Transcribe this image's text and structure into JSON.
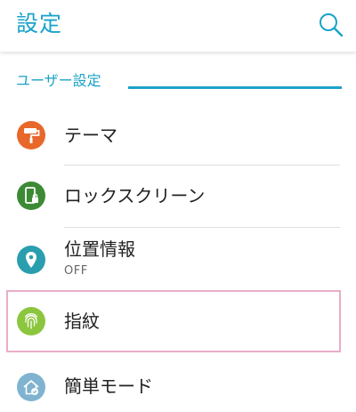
{
  "header": {
    "title": "設定",
    "search_icon": "search-icon"
  },
  "section": {
    "title": "ユーザー設定"
  },
  "items": [
    {
      "label": "テーマ",
      "icon": "paint-roller-icon",
      "icon_color": "#e8672b"
    },
    {
      "label": "ロックスクリーン",
      "icon": "phone-lock-icon",
      "icon_color": "#3d8a34"
    },
    {
      "label": "位置情報",
      "sub": "OFF",
      "icon": "location-pin-icon",
      "icon_color": "#2a9eae"
    },
    {
      "label": "指紋",
      "icon": "fingerprint-icon",
      "icon_color": "#8cc63f"
    },
    {
      "label": "簡単モード",
      "icon": "easy-home-icon",
      "icon_color": "#7fb3cf"
    }
  ],
  "colors": {
    "accent": "#1aa3c9",
    "highlight_border": "#e8aec8"
  }
}
